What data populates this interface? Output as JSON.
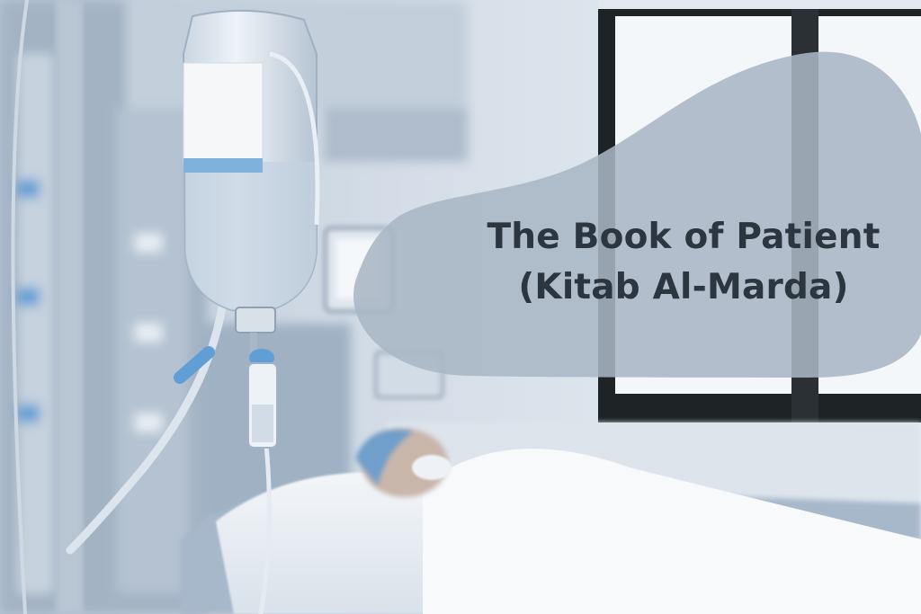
{
  "title": {
    "line1": "The Book of Patient",
    "line2": "(Kitab Al-Marda)"
  },
  "colors": {
    "blob": "#a9b6c4",
    "text": "#2c3640",
    "accent_blue": "#5f9fd6",
    "window_frame": "#1e2326",
    "sky": "#f4f7fa"
  },
  "scene": {
    "subject": "hospital-icu-patient-bed",
    "elements": [
      "iv-bag-icon",
      "drip-chamber-icon",
      "window-icon",
      "hospital-bed-icon",
      "medical-monitor-icon"
    ]
  }
}
